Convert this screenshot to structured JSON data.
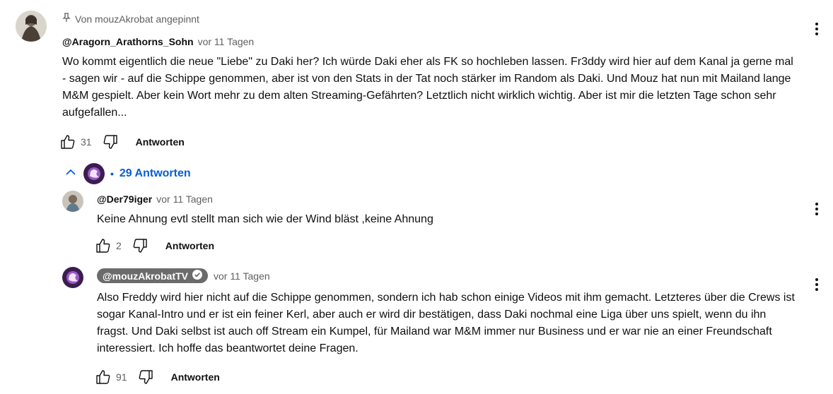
{
  "comment": {
    "pinned_label": "Von mouzAkrobat angepinnt",
    "author": "@Aragorn_Arathorns_Sohn",
    "time": "vor 11 Tagen",
    "text": "Wo kommt eigentlich die neue \"Liebe\" zu Daki her? Ich würde Daki eher als FK so hochleben lassen. Fr3ddy wird hier auf dem Kanal ja gerne mal - sagen wir - auf die Schippe genommen, aber ist von den Stats in der Tat noch stärker im Random als Daki. Und Mouz hat nun mit Mailand lange M&M gespielt. Aber kein Wort mehr zu dem alten Streaming-Gefährten? Letztlich nicht wirklich wichtig. Aber ist mir die letzten Tage schon sehr aufgefallen...",
    "likes": "31",
    "reply_label": "Antworten"
  },
  "replies_toggle": {
    "bullet": "•",
    "label": "29 Antworten"
  },
  "replies": [
    {
      "author": "@Der79iger",
      "time": "vor 11 Tagen",
      "text": "Keine Ahnung evtl stellt man sich wie der Wind bläst ,keine Ahnung",
      "likes": "2",
      "reply_label": "Antworten"
    },
    {
      "author": "@mouzAkrobatTV",
      "time": "vor 11 Tagen",
      "text": "Also Freddy wird hier nicht auf die Schippe genommen, sondern ich hab schon einige Videos mit ihm gemacht. Letzteres über die Crews ist sogar Kanal-Intro und er ist ein feiner Kerl, aber auch er wird dir bestätigen, dass Daki nochmal eine Liga über uns spielt, wenn du ihn fragst. Und Daki selbst ist auch off Stream ein Kumpel, für Mailand war M&M immer nur Business und er war nie an einer Freundschaft interessiert. Ich hoffe das beantwortet deine Fragen.",
      "likes": "91",
      "reply_label": "Antworten"
    }
  ],
  "colors": {
    "link": "#065fd4",
    "secondary_text": "#606060",
    "owner_badge": "#6b6b6b"
  }
}
